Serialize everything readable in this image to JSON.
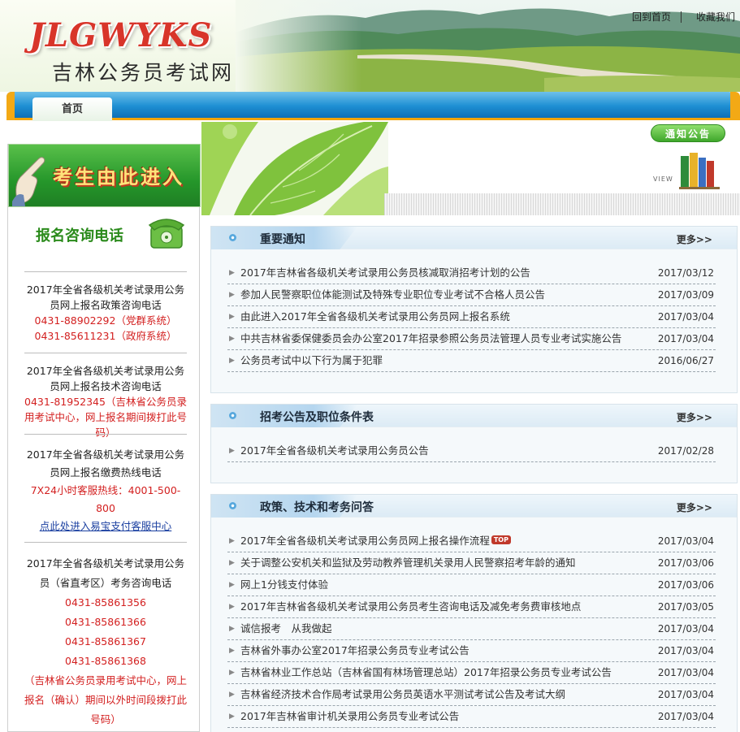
{
  "header": {
    "logo_text": "JLGWYKS",
    "site_title": "吉林公务员考试网",
    "links": [
      "回到首页",
      "收藏我们"
    ]
  },
  "nav": {
    "home": "首页"
  },
  "banner": {
    "notice": "通知公告",
    "view": "VIEW"
  },
  "sidebar": {
    "enter_text": "考生由此进入",
    "consult_title": "报名咨询电话",
    "block1": {
      "title": "2017年全省各级机关考试录用公务员网上报名政策咨询电话",
      "phones": [
        "0431-88902292（党群系统）",
        "0431-85611231（政府系统）"
      ]
    },
    "block2": {
      "title": "2017年全省各级机关考试录用公务员网上报名技术咨询电话",
      "phone": "0431-81952345（吉林省公务员录用考试中心，网上报名期间拨打此号码）"
    },
    "block3": {
      "title": "2017年全省各级机关考试录用公务员网上报名缴费热线电话",
      "hotline": "7X24小时客服热线：4001-500-800",
      "link": "点此处进入易宝支付客服中心"
    },
    "block4": {
      "title": "2017年全省各级机关考试录用公务员（省直考区）考务咨询电话",
      "phones": [
        "0431-85861356",
        "0431-85861366",
        "0431-85861367",
        "0431-85861368"
      ],
      "note": "（吉林省公务员录用考试中心，网上报名（确认）期间以外时间段拨打此号码）"
    }
  },
  "panels": [
    {
      "title": "重要通知",
      "more": "更多>>",
      "items": [
        {
          "text": "2017年吉林省各级机关考试录用公务员核减取消招考计划的公告",
          "date": "2017/03/12"
        },
        {
          "text": "参加人民警察职位体能测试及特殊专业职位专业考试不合格人员公告",
          "date": "2017/03/09"
        },
        {
          "text": "由此进入2017年全省各级机关考试录用公务员网上报名系统",
          "date": "2017/03/04"
        },
        {
          "text": "中共吉林省委保健委员会办公室2017年招录参照公务员法管理人员专业考试实施公告",
          "date": "2017/03/04"
        },
        {
          "text": "公务员考试中以下行为属于犯罪",
          "date": "2016/06/27"
        }
      ]
    },
    {
      "title": "招考公告及职位条件表",
      "more": "更多>>",
      "items": [
        {
          "text": "2017年全省各级机关考试录用公务员公告",
          "date": "2017/02/28"
        }
      ]
    },
    {
      "title": "政策、技术和考务问答",
      "more": "更多>>",
      "items": [
        {
          "text": "2017年全省各级机关考试录用公务员网上报名操作流程",
          "date": "2017/03/04",
          "badge": "TOP"
        },
        {
          "text": "关于调整公安机关和监狱及劳动教养管理机关录用人民警察招考年龄的通知",
          "date": "2017/03/06"
        },
        {
          "text": "网上1分钱支付体验",
          "date": "2017/03/06"
        },
        {
          "text": "2017年吉林省各级机关考试录用公务员考生咨询电话及减免考务费审核地点",
          "date": "2017/03/05"
        },
        {
          "text": "诚信报考　从我做起",
          "date": "2017/03/04"
        },
        {
          "text": "吉林省外事办公室2017年招录公务员专业考试公告",
          "date": "2017/03/04"
        },
        {
          "text": "吉林省林业工作总站（吉林省国有林场管理总站）2017年招录公务员专业考试公告",
          "date": "2017/03/04"
        },
        {
          "text": "吉林省经济技术合作局考试录用公务员英语水平测试考试公告及考试大纲",
          "date": "2017/03/04"
        },
        {
          "text": "2017年吉林省审计机关录用公务员专业考试公告",
          "date": "2017/03/04"
        }
      ]
    }
  ]
}
